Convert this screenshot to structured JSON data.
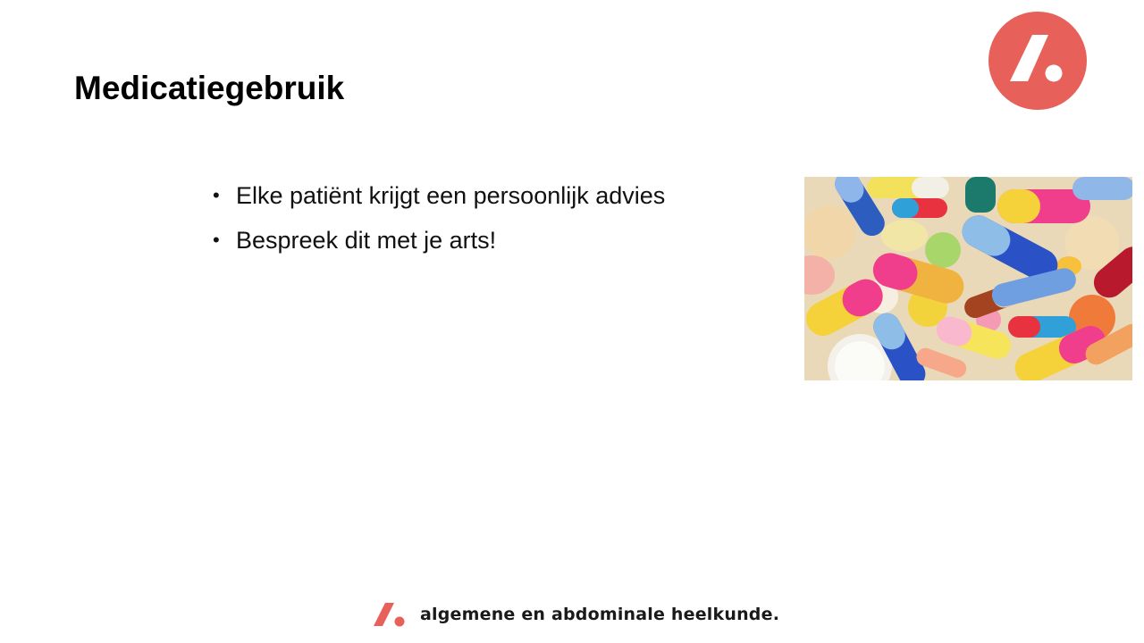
{
  "slide": {
    "title": "Medicatiegebruik",
    "bullets": [
      "Elke patiënt krijgt een persoonlijk advies",
      "Bespreek dit met je arts!"
    ],
    "bullet_glyph": "•"
  },
  "logo": {
    "icon": "slash-dot-logo-icon",
    "color": "#e8605a"
  },
  "image": {
    "subject": "colorful-pills-photo"
  },
  "footer": {
    "text": "algemene en abdominale  heelkunde.",
    "icon": "slash-dot-logo-icon",
    "color": "#e8605a"
  }
}
